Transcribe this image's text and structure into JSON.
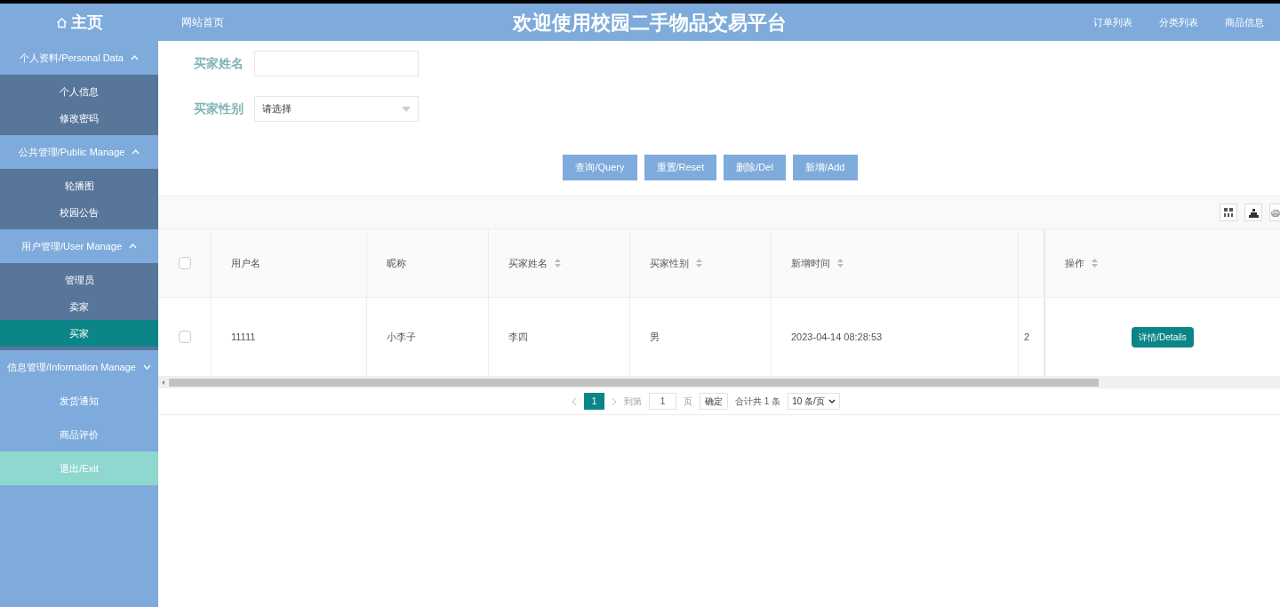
{
  "header": {
    "home": "主页",
    "site_link": "网站首页",
    "title": "欢迎使用校园二手物品交易平台",
    "nav": [
      "订单列表",
      "分类列表",
      "商品信息"
    ]
  },
  "sidebar": {
    "groups": [
      {
        "label": "个人资料/Personal Data",
        "expanded": true,
        "items": [
          {
            "label": "个人信息",
            "selected": false
          },
          {
            "label": "修改密码",
            "selected": false
          }
        ]
      },
      {
        "label": "公共管理/Public Manage",
        "expanded": true,
        "items": [
          {
            "label": "轮播图",
            "selected": false
          },
          {
            "label": "校园公告",
            "selected": false
          }
        ]
      },
      {
        "label": "用户管理/User Manage",
        "expanded": true,
        "items": [
          {
            "label": "管理员",
            "selected": false
          },
          {
            "label": "卖家",
            "selected": false
          },
          {
            "label": "买家",
            "selected": true
          }
        ]
      },
      {
        "label": "信息管理/Information Manage",
        "expanded": false,
        "items": [
          {
            "label": "发货通知",
            "selected": false
          },
          {
            "label": "商品评价",
            "selected": false
          }
        ]
      }
    ],
    "exit": "退出/Exit"
  },
  "filters": [
    {
      "kind": "text",
      "label": "买家姓名"
    },
    {
      "kind": "select",
      "label": "买家性别",
      "placeholder": "请选择"
    }
  ],
  "actions": [
    "查询/Query",
    "重置/Reset",
    "删除/Del",
    "新增/Add"
  ],
  "table": {
    "columns": [
      {
        "label": "用户名",
        "sortable": false
      },
      {
        "label": "昵称",
        "sortable": false
      },
      {
        "label": "买家姓名",
        "sortable": true
      },
      {
        "label": "买家性别",
        "sortable": true
      },
      {
        "label": "新增时间",
        "sortable": true
      },
      {
        "label": "操作",
        "sortable": true
      }
    ],
    "header_checked": false,
    "rows": [
      {
        "checked": false,
        "cells": [
          "11111",
          "小李子",
          "李四",
          "男",
          "2023-04-14 08:28:53",
          "2"
        ],
        "action": "详情/Details"
      }
    ]
  },
  "pagination": {
    "pages": [
      {
        "label": "1",
        "selected": true
      }
    ],
    "goto": "到第",
    "page_value": "1",
    "page_unit": "页",
    "confirm": "确定",
    "total": "合计共 1 条",
    "page_size": "10 条/页"
  }
}
